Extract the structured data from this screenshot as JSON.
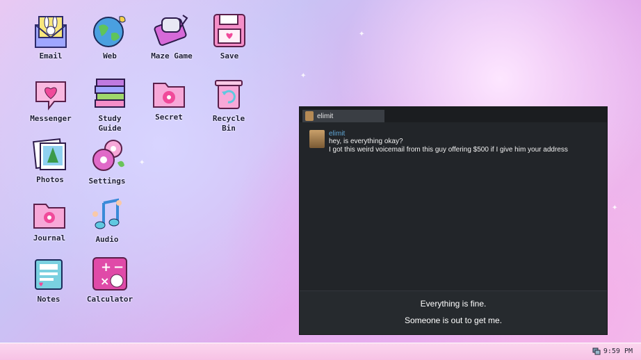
{
  "desktop": {
    "icons": [
      {
        "label": "Email",
        "icon": "email-icon"
      },
      {
        "label": "Web",
        "icon": "globe-icon"
      },
      {
        "label": "Maze Game",
        "icon": "maze-game-icon"
      },
      {
        "label": "Save",
        "icon": "floppy-disk-icon"
      },
      {
        "label": "Messenger",
        "icon": "heart-chat-icon"
      },
      {
        "label": "Study\nGuide",
        "icon": "books-icon"
      },
      {
        "label": "Secret",
        "icon": "flower-folder-icon"
      },
      {
        "label": "Recycle\nBin",
        "icon": "recycle-bin-icon"
      },
      {
        "label": "Photos",
        "icon": "photos-icon"
      },
      {
        "label": "Settings",
        "icon": "gear-flower-icon"
      },
      {
        "label": "Journal",
        "icon": "journal-folder-icon"
      },
      {
        "label": "Audio",
        "icon": "music-note-icon"
      },
      {
        "label": "Notes",
        "icon": "notes-icon"
      },
      {
        "label": "Calculator",
        "icon": "calculator-icon"
      }
    ]
  },
  "chat": {
    "tab_label": "elimit",
    "message": {
      "sender": "elimit",
      "lines": [
        "hey, is everything okay?",
        "I got this weird voicemail from this guy offering $500 if I give him your address"
      ]
    },
    "choices": [
      "Everything is fine.",
      "Someone is out to get me."
    ]
  },
  "taskbar": {
    "clock": "9:59 PM"
  },
  "colors": {
    "accent": "#5fa6d6",
    "window": "#222529",
    "taskbar": "#f7c2e5"
  }
}
